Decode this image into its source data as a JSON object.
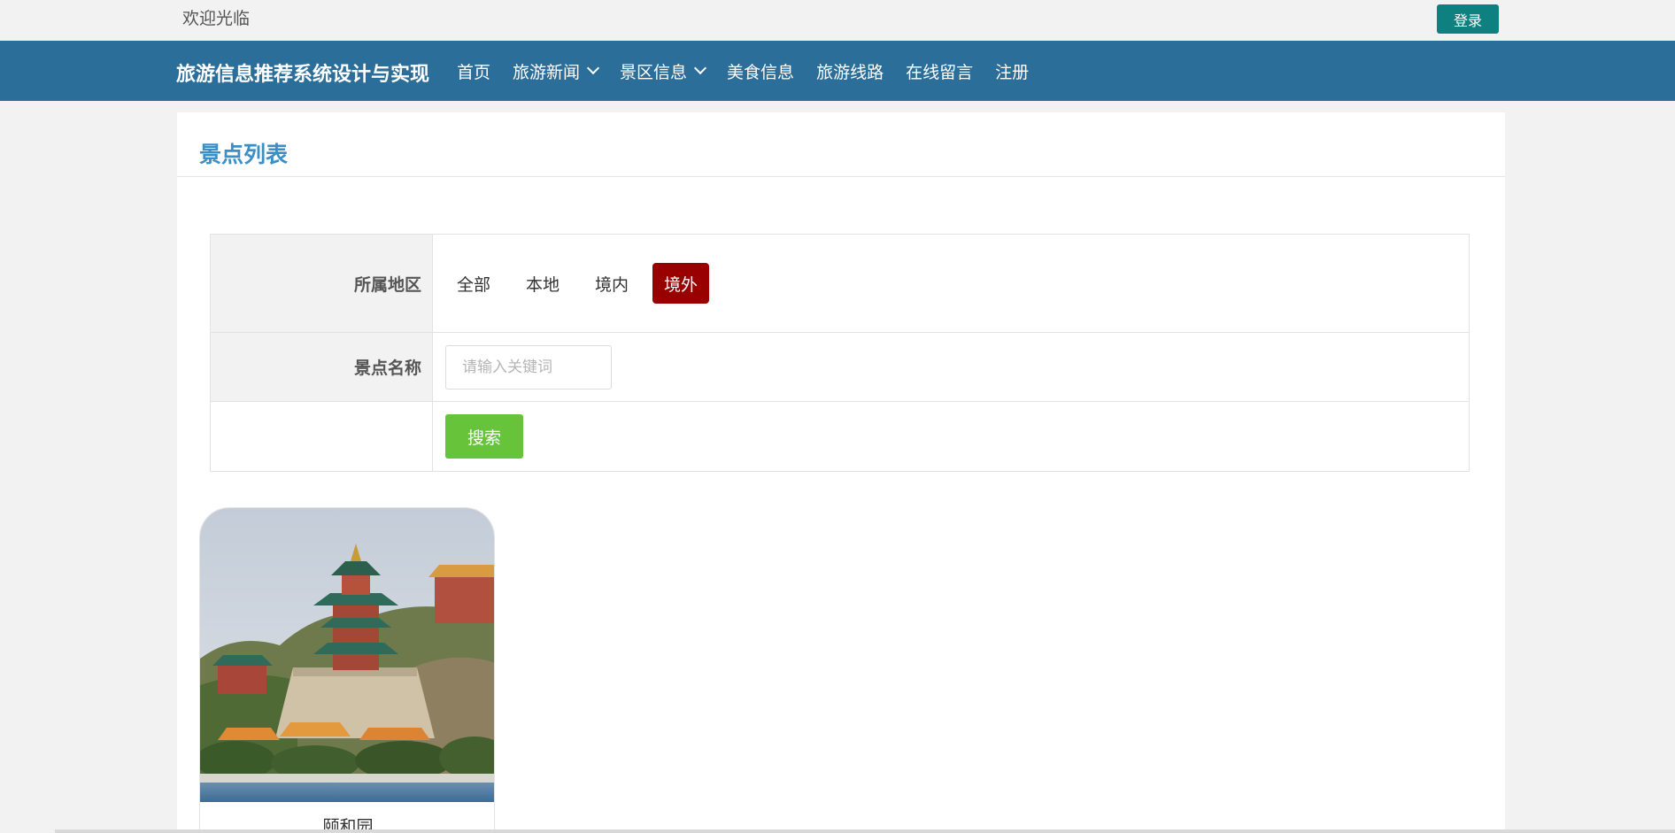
{
  "header": {
    "welcome": "欢迎光临",
    "login_label": "登录"
  },
  "navbar": {
    "brand": "旅游信息推荐系统设计与实现",
    "items": [
      {
        "label": "首页",
        "dropdown": false
      },
      {
        "label": "旅游新闻",
        "dropdown": true
      },
      {
        "label": "景区信息",
        "dropdown": true
      },
      {
        "label": "美食信息",
        "dropdown": false
      },
      {
        "label": "旅游线路",
        "dropdown": false
      },
      {
        "label": "在线留言",
        "dropdown": false
      },
      {
        "label": "注册",
        "dropdown": false
      }
    ]
  },
  "page": {
    "title": "景点列表"
  },
  "filter": {
    "region_label": "所属地区",
    "region_options": [
      "全部",
      "本地",
      "境内",
      "境外"
    ],
    "region_selected": "境外",
    "name_label": "景点名称",
    "name_placeholder": "请输入关键词",
    "name_value": "",
    "search_label": "搜索"
  },
  "results": [
    {
      "name": "颐和园",
      "image": "summer-palace-photo"
    }
  ],
  "colors": {
    "navbar": "#2b6e9a",
    "login_button": "#0e8080",
    "title": "#3a8fc6",
    "active_option": "#990000",
    "search_button": "#66c33a"
  }
}
